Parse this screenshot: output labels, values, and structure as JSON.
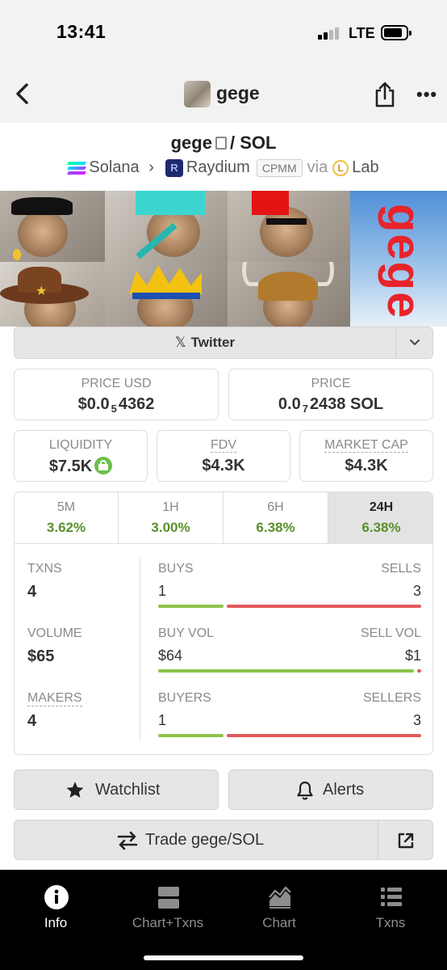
{
  "status_bar": {
    "time": "13:41",
    "network": "LTE"
  },
  "header": {
    "title": "gege"
  },
  "pair": {
    "base": "gege",
    "separator": "/",
    "quote": "SOL",
    "chain": "Solana",
    "dex": "Raydium",
    "pool_type": "CPMM",
    "via_label": "via",
    "via": "Lab"
  },
  "social": {
    "twitter_label": "Twitter"
  },
  "stats": {
    "price_usd": {
      "label": "PRICE USD",
      "prefix": "$0.0",
      "zeros": "5",
      "digits": "4362"
    },
    "price_native": {
      "label": "PRICE",
      "prefix": "0.0",
      "zeros": "7",
      "digits": "2438 SOL"
    },
    "liquidity": {
      "label": "LIQUIDITY",
      "value": "$7.5K"
    },
    "fdv": {
      "label": "FDV",
      "value": "$4.3K"
    },
    "market_cap": {
      "label": "MARKET CAP",
      "value": "$4.3K"
    }
  },
  "timeframes": [
    {
      "label": "5M",
      "change": "3.62%"
    },
    {
      "label": "1H",
      "change": "3.00%"
    },
    {
      "label": "6H",
      "change": "6.38%"
    },
    {
      "label": "24H",
      "change": "6.38%",
      "active": true
    }
  ],
  "metrics": {
    "txns": {
      "label": "TXNS",
      "value": "4",
      "left_label": "BUYS",
      "left_value": "1",
      "right_label": "SELLS",
      "right_value": "3",
      "left_share": 0.25
    },
    "volume": {
      "label": "VOLUME",
      "value": "$65",
      "left_label": "BUY VOL",
      "left_value": "$64",
      "right_label": "SELL VOL",
      "right_value": "$1",
      "left_share": 0.985
    },
    "makers": {
      "label": "MAKERS",
      "value": "4",
      "left_label": "BUYERS",
      "left_value": "1",
      "right_label": "SELLERS",
      "right_value": "3",
      "left_share": 0.25
    }
  },
  "actions": {
    "watchlist": "Watchlist",
    "alerts": "Alerts",
    "trade": "Trade gege/SOL"
  },
  "tabs": [
    {
      "label": "Info",
      "icon": "info-icon",
      "active": true
    },
    {
      "label": "Chart+Txns",
      "icon": "split-view-icon"
    },
    {
      "label": "Chart",
      "icon": "area-chart-icon"
    },
    {
      "label": "Txns",
      "icon": "list-icon"
    }
  ],
  "colors": {
    "positive": "#5a8f2a",
    "buy_bar": "#8bc34a",
    "sell_bar": "#e25b5b",
    "tabbar": "#000000"
  }
}
